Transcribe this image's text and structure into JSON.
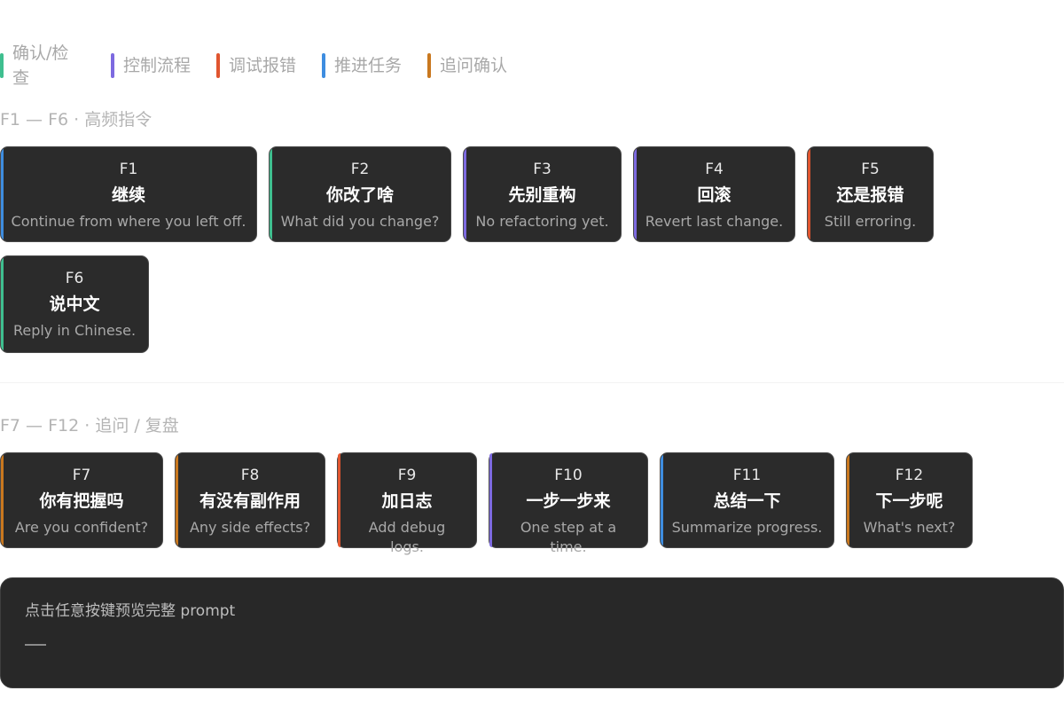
{
  "legend": [
    {
      "label": "确认/检查",
      "color": "#3fbf8f"
    },
    {
      "label": "控制流程",
      "color": "#7d6ae0"
    },
    {
      "label": "调试报错",
      "color": "#e0552f"
    },
    {
      "label": "推进任务",
      "color": "#3e8de0"
    },
    {
      "label": "追问确认",
      "color": "#c9781f"
    }
  ],
  "sections": {
    "high_freq_title": "F1 — F6 · 高频指令",
    "followup_title": "F7 — F12 · 追问 / 复盘"
  },
  "keys": [
    {
      "code": "F1",
      "cn": "继续",
      "en": "Continue from where you left off.",
      "color": "#3e8de0"
    },
    {
      "code": "F2",
      "cn": "你改了啥",
      "en": "What did you change?",
      "color": "#3fbf8f"
    },
    {
      "code": "F3",
      "cn": "先别重构",
      "en": "No refactoring yet.",
      "color": "#7d6ae0"
    },
    {
      "code": "F4",
      "cn": "回滚",
      "en": "Revert last change.",
      "color": "#7d6ae0"
    },
    {
      "code": "F5",
      "cn": "还是报错",
      "en": "Still erroring.",
      "color": "#e0552f"
    },
    {
      "code": "F6",
      "cn": "说中文",
      "en": "Reply in Chinese.",
      "color": "#3fbf8f"
    },
    {
      "code": "F7",
      "cn": "你有把握吗",
      "en": "Are you confident?",
      "color": "#c9781f"
    },
    {
      "code": "F8",
      "cn": "有没有副作用",
      "en": "Any side effects?",
      "color": "#c9781f"
    },
    {
      "code": "F9",
      "cn": "加日志",
      "en": "Add debug logs.",
      "color": "#e0552f"
    },
    {
      "code": "F10",
      "cn": "一步一步来",
      "en": "One step at a time.",
      "color": "#7d6ae0"
    },
    {
      "code": "F11",
      "cn": "总结一下",
      "en": "Summarize progress.",
      "color": "#3e8de0"
    },
    {
      "code": "F12",
      "cn": "下一步呢",
      "en": "What's next?",
      "color": "#c9781f"
    }
  ],
  "preview": {
    "hint": "点击任意按键预览完整 prompt"
  }
}
